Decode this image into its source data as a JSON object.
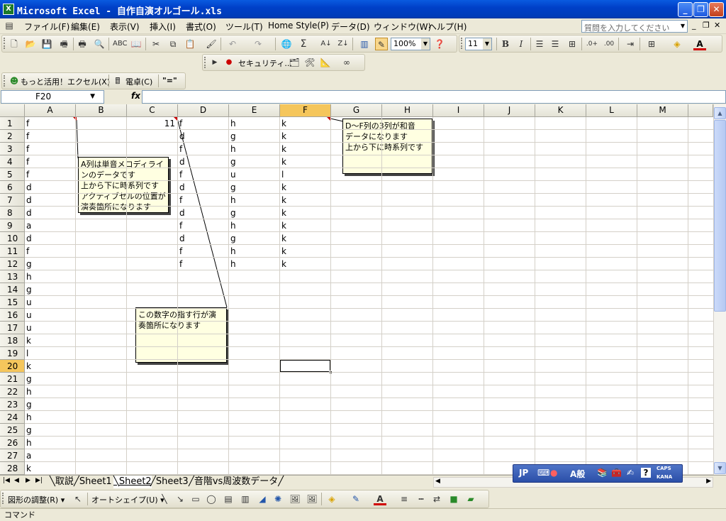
{
  "window": {
    "title": "Microsoft Excel - 自作自演オルゴール.xls",
    "app_icon": "excel-icon"
  },
  "menu": {
    "items": [
      "ファイル(F)",
      "編集(E)",
      "表示(V)",
      "挿入(I)",
      "書式(O)",
      "ツール(T)",
      "Home Style(P)",
      "データ(D)",
      "ウィンドウ(W)",
      "ヘルプ(H)"
    ],
    "help_placeholder": "質問を入力してください"
  },
  "toolbar": {
    "zoom": "100%",
    "font_size": "11",
    "bold": "B",
    "italic": "I"
  },
  "security_toolbar": {
    "label": "セキュリティ..."
  },
  "extra_toolbar": {
    "item1": "もっと活用！エクセル(X)",
    "item2": "電卓(C)",
    "item3": "\"=\""
  },
  "formula_bar": {
    "name_box": "F20",
    "fx": "fx",
    "value": ""
  },
  "grid": {
    "columns": [
      "A",
      "B",
      "C",
      "D",
      "E",
      "F",
      "G",
      "H",
      "I",
      "J",
      "K",
      "L",
      "M"
    ],
    "active_column": "F",
    "active_row": 20,
    "rows": [
      "1",
      "2",
      "3",
      "4",
      "5",
      "6",
      "7",
      "8",
      "9",
      "10",
      "11",
      "12",
      "13",
      "14",
      "15",
      "16",
      "17",
      "18",
      "19",
      "20",
      "21",
      "22",
      "23",
      "24",
      "25",
      "26",
      "27",
      "28"
    ],
    "col_a": [
      "f",
      "f",
      "f",
      "f",
      "f",
      "d",
      "d",
      "d",
      "a",
      "d",
      "f",
      "g",
      "h",
      "g",
      "u",
      "u",
      "u",
      "k",
      "l",
      "k",
      "g",
      "h",
      "g",
      "h",
      "g",
      "h",
      "a",
      "k"
    ],
    "c1": "11",
    "col_d": [
      "f",
      "d",
      "f",
      "d",
      "f",
      "d",
      "f",
      "d",
      "f",
      "d",
      "f",
      "f"
    ],
    "col_e": [
      "h",
      "g",
      "h",
      "g",
      "u",
      "g",
      "h",
      "g",
      "h",
      "g",
      "h",
      "h"
    ],
    "col_f": [
      "k",
      "k",
      "k",
      "k",
      "l",
      "k",
      "k",
      "k",
      "k",
      "k",
      "k",
      "k"
    ]
  },
  "comments": {
    "a1": "A列は単音メロディライ\nンのデータです\n上から下に時系列です\nアクティブセルの位置が\n演奏箇所になります",
    "f1": "D～F列の3列が和音\nデータになります\n上から下に時系列です",
    "c1": "この数字の指す行が演\n奏箇所になります"
  },
  "sheets": {
    "tabs": [
      "取説",
      "Sheet1",
      "Sheet2",
      "Sheet3",
      "音階vs周波数データ"
    ],
    "active": "Sheet2"
  },
  "ime": {
    "mode": "JP",
    "kanji": "A般",
    "caps": "CAPS",
    "kana": "KANA"
  },
  "draw_toolbar": {
    "adjust": "図形の調整(R)",
    "autoshape": "オートシェイプ(U)"
  },
  "status": {
    "text": "コマンド"
  }
}
